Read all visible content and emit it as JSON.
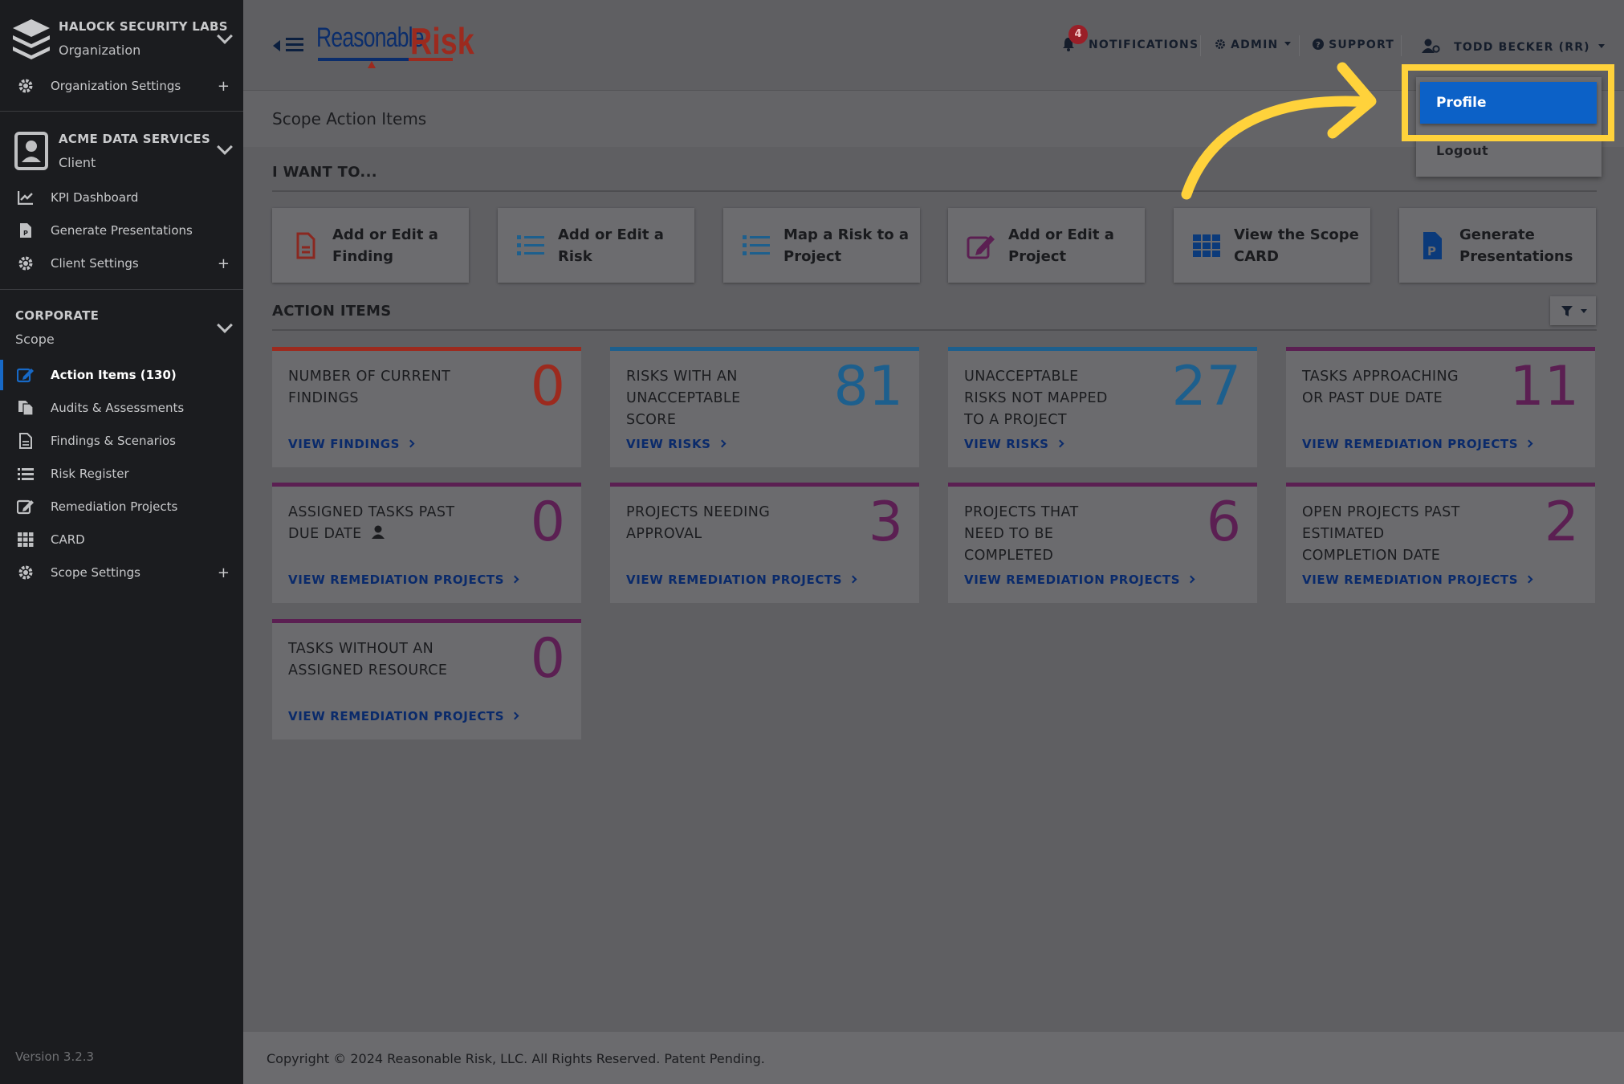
{
  "sidebar": {
    "org": {
      "name": "HALOCK SECURITY LABS",
      "type": "Organization"
    },
    "org_settings": "Organization Settings",
    "client": {
      "name": "ACME DATA SERVICES",
      "type": "Client"
    },
    "client_items": [
      "KPI Dashboard",
      "Generate Presentations",
      "Client Settings"
    ],
    "scope": {
      "name": "CORPORATE",
      "type": "Scope"
    },
    "scope_items": [
      "Action Items (130)",
      "Audits & Assessments",
      "Findings & Scenarios",
      "Risk Register",
      "Remediation Projects",
      "CARD",
      "Scope Settings"
    ],
    "version": "Version 3.2.3"
  },
  "header": {
    "logo_part1": "Reasonable",
    "logo_part2": "Risk",
    "notifications_count": "4",
    "notifications": "NOTIFICATIONS",
    "admin": "ADMIN",
    "support": "SUPPORT",
    "user": "TODD BECKER (RR)"
  },
  "dropdown": {
    "profile": "Profile",
    "logout": "Logout"
  },
  "page": {
    "title": "Scope Action Items",
    "i_want_to": "I WANT TO...",
    "action_items": "ACTION ITEMS"
  },
  "quick_actions": [
    "Add or Edit a Finding",
    "Add or Edit a Risk",
    "Map a Risk to a Project",
    "Add or Edit a Project",
    "View the Scope CARD",
    "Generate Presentations"
  ],
  "cards": [
    {
      "title": "NUMBER OF CURRENT FINDINGS",
      "value": "0",
      "link": "VIEW FINDINGS",
      "color": "#9c2a1e"
    },
    {
      "title": "RISKS WITH AN UNACCEPTABLE SCORE",
      "value": "81",
      "link": "VIEW RISKS",
      "color": "#1d5f8d"
    },
    {
      "title": "UNACCEPTABLE RISKS NOT MAPPED TO A PROJECT",
      "value": "27",
      "link": "VIEW RISKS",
      "color": "#1d5f8d"
    },
    {
      "title": "TASKS APPROACHING OR PAST DUE DATE",
      "value": "11",
      "link": "VIEW REMEDIATION PROJECTS",
      "color": "#5b1f52"
    },
    {
      "title": "ASSIGNED TASKS PAST DUE DATE",
      "value": "0",
      "link": "VIEW REMEDIATION PROJECTS",
      "color": "#5b1f52"
    },
    {
      "title": "PROJECTS NEEDING APPROVAL",
      "value": "3",
      "link": "VIEW REMEDIATION PROJECTS",
      "color": "#5b1f52"
    },
    {
      "title": "PROJECTS THAT NEED TO BE COMPLETED",
      "value": "6",
      "link": "VIEW REMEDIATION PROJECTS",
      "color": "#5b1f52"
    },
    {
      "title": "OPEN PROJECTS PAST ESTIMATED COMPLETION DATE",
      "value": "2",
      "link": "VIEW REMEDIATION PROJECTS",
      "color": "#5b1f52"
    },
    {
      "title": "TASKS WITHOUT AN ASSIGNED RESOURCE",
      "value": "0",
      "link": "VIEW REMEDIATION PROJECTS",
      "color": "#5b1f52"
    }
  ],
  "footer": "Copyright © 2024 Reasonable Risk, LLC. All Rights Reserved. Patent Pending.",
  "colors": {
    "accent": "#0c61c7",
    "highlight": "#ffd23b",
    "sidebar": "#1b1c1f",
    "overlay": "#5f5f62"
  },
  "icons": [
    "layers-icon",
    "gear-icon",
    "contact-card-icon",
    "chart-line-icon",
    "file-icon",
    "list-icon",
    "edit-icon",
    "copy-icon",
    "grid-icon",
    "bell-icon",
    "question-icon",
    "user-gear-icon",
    "filter-icon",
    "user-icon"
  ]
}
